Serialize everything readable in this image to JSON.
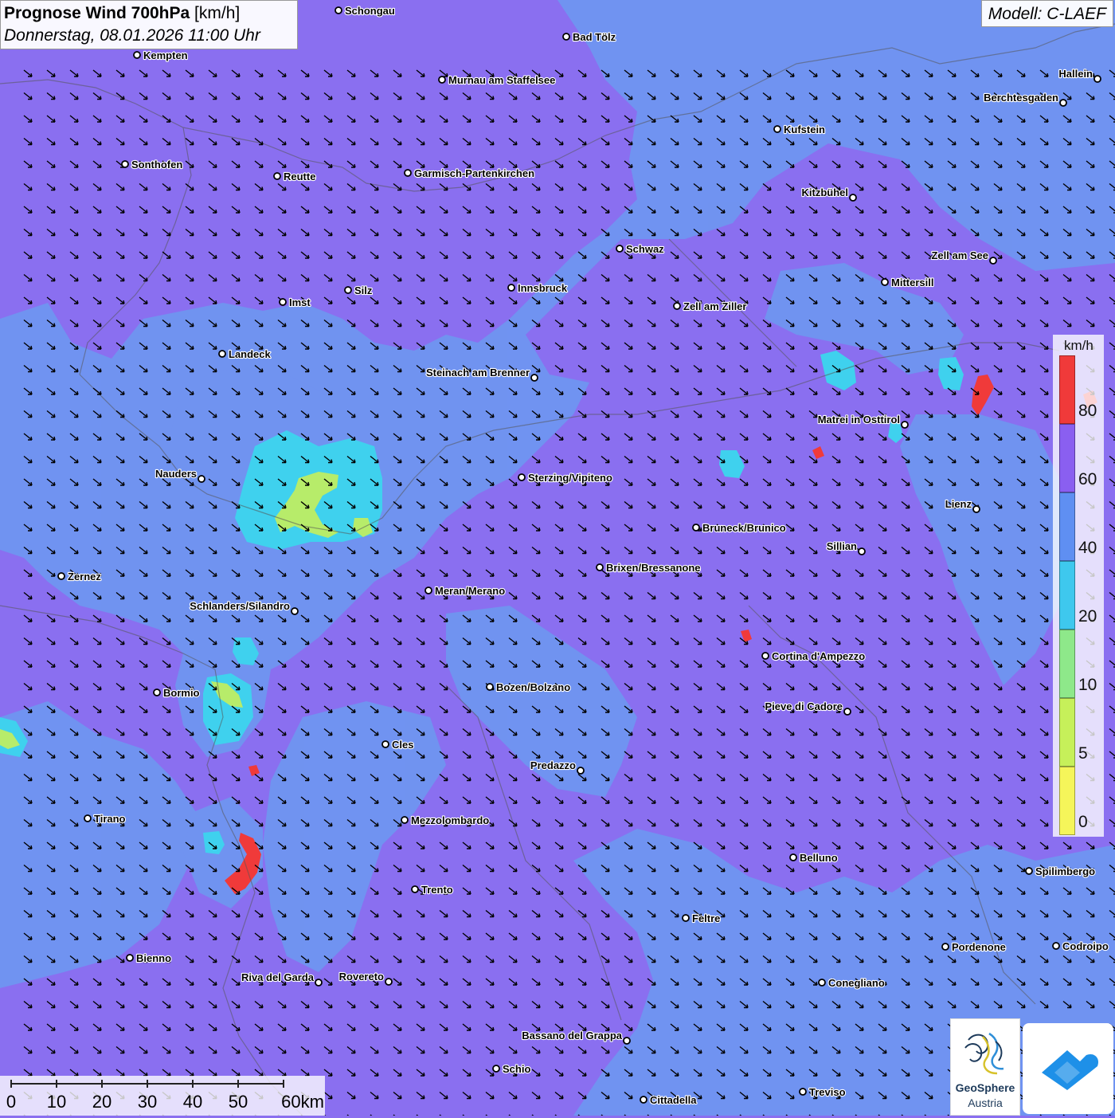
{
  "header": {
    "title_bold": "Prognose Wind 700hPa",
    "title_unit": "[km/h]",
    "datetime": "Donnerstag, 08.01.2026 11:00 Uhr",
    "model": "Modell: C-LAEF"
  },
  "legend": {
    "unit": "km/h",
    "classes": [
      {
        "label": "0",
        "color": "#f5f55a"
      },
      {
        "label": "5",
        "color": "#c6f05a"
      },
      {
        "label": "10",
        "color": "#8ee88a"
      },
      {
        "label": "20",
        "color": "#3ec8ee"
      },
      {
        "label": "40",
        "color": "#5f8ff2"
      },
      {
        "label": "60",
        "color": "#8a5ff0"
      },
      {
        "label": "80",
        "color": "#f03a3a"
      }
    ]
  },
  "scalebar": {
    "labels": [
      "0",
      "10",
      "20",
      "30",
      "40",
      "50",
      "60km"
    ]
  },
  "cities": [
    {
      "name": "Schongau"
    },
    {
      "name": "Bad Tölz"
    },
    {
      "name": "Kempten"
    },
    {
      "name": "Murnau am Staffelsee"
    },
    {
      "name": "Hallein"
    },
    {
      "name": "Berchtesgaden"
    },
    {
      "name": "Kufstein"
    },
    {
      "name": "Sonthofen"
    },
    {
      "name": "Reutte"
    },
    {
      "name": "Garmisch-Partenkirchen"
    },
    {
      "name": "Kitzbühel"
    },
    {
      "name": "Schwaz"
    },
    {
      "name": "Zell am See"
    },
    {
      "name": "Mittersill"
    },
    {
      "name": "Innsbruck"
    },
    {
      "name": "Silz"
    },
    {
      "name": "Imst"
    },
    {
      "name": "Zell am Ziller"
    },
    {
      "name": "Landeck"
    },
    {
      "name": "Steinach am Brenner"
    },
    {
      "name": "Matrei in Osttirol"
    },
    {
      "name": "Nauders"
    },
    {
      "name": "Sterzing/Vipiteno"
    },
    {
      "name": "Lienz"
    },
    {
      "name": "Bruneck/Brunico"
    },
    {
      "name": "Sillian"
    },
    {
      "name": "Zernez"
    },
    {
      "name": "Brixen/Bressanone"
    },
    {
      "name": "Meran/Merano"
    },
    {
      "name": "Schlanders/Silandro"
    },
    {
      "name": "Cortina d'Ampezzo"
    },
    {
      "name": "Bormio"
    },
    {
      "name": "Bozen/Bolzano"
    },
    {
      "name": "Pieve di Cadore"
    },
    {
      "name": "Cles"
    },
    {
      "name": "Predazzo"
    },
    {
      "name": "Tirano"
    },
    {
      "name": "Mezzolombardo"
    },
    {
      "name": "Belluno"
    },
    {
      "name": "Spilimbergo"
    },
    {
      "name": "Trento"
    },
    {
      "name": "Feltre"
    },
    {
      "name": "Bienno"
    },
    {
      "name": "Pordenone"
    },
    {
      "name": "Codroipo"
    },
    {
      "name": "Riva del Garda"
    },
    {
      "name": "Rovereto"
    },
    {
      "name": "Conegliano"
    },
    {
      "name": "Bassano del Grappa"
    },
    {
      "name": "Schio"
    },
    {
      "name": "Treviso"
    },
    {
      "name": "Cittadella"
    }
  ],
  "logos": {
    "geosphere_line1": "GeoSphere",
    "geosphere_line2": "Austria"
  }
}
